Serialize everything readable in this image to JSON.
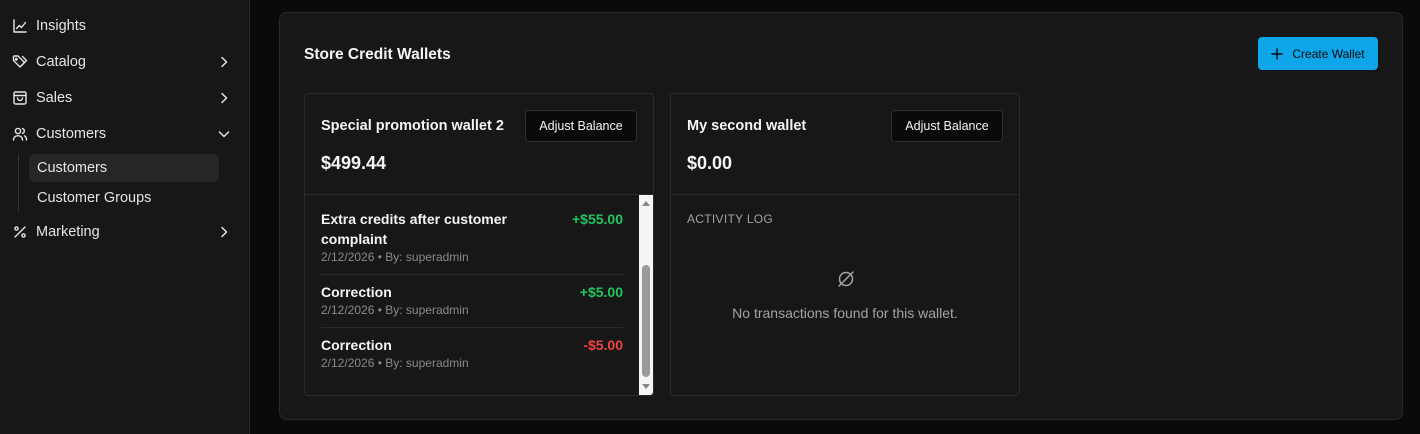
{
  "sidebar": {
    "items": [
      {
        "label": "Insights",
        "icon": "chart-line-icon"
      },
      {
        "label": "Catalog",
        "icon": "tag-icon"
      },
      {
        "label": "Sales",
        "icon": "shopping-bag-icon"
      },
      {
        "label": "Customers",
        "icon": "users-icon"
      },
      {
        "label": "Marketing",
        "icon": "percent-icon"
      }
    ],
    "customers_sub": [
      {
        "label": "Customers"
      },
      {
        "label": "Customer Groups"
      }
    ]
  },
  "page": {
    "title": "Store Credit Wallets",
    "create_label": "Create Wallet"
  },
  "wallets": [
    {
      "name": "Special promotion wallet 2",
      "balance": "$499.44",
      "adjust_label": "Adjust Balance",
      "transactions": [
        {
          "description": "Extra credits after customer complaint",
          "meta": "2/12/2026 • By: superadmin",
          "amount": "+$55.00"
        },
        {
          "description": "Correction",
          "meta": "2/12/2026 • By: superadmin",
          "amount": "+$5.00"
        },
        {
          "description": "Correction",
          "meta": "2/12/2026 • By: superadmin",
          "amount": "-$5.00"
        }
      ]
    },
    {
      "name": "My second wallet",
      "balance": "$0.00",
      "adjust_label": "Adjust Balance",
      "activity_label": "ACTIVITY LOG",
      "empty_text": "No transactions found for this wallet."
    }
  ],
  "colors": {
    "accent": "#0ea5e9",
    "positive": "#22c55e",
    "negative": "#ef4444"
  }
}
